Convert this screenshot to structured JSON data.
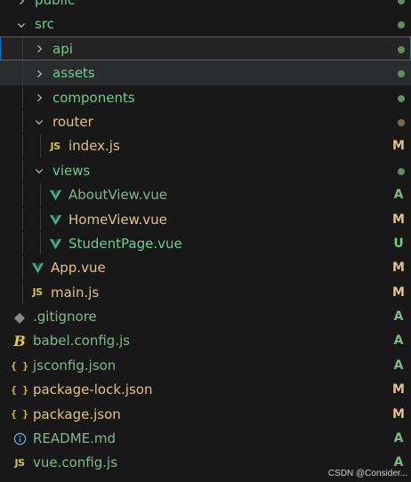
{
  "colors": {
    "untracked": "#73c991",
    "added": "#81b88b",
    "modified": "#e2c08d",
    "dot_green": "#5f8f5f",
    "dot_brown": "#7d6a4d",
    "vue_green": "#41b883",
    "info_blue": "#6ca6d9"
  },
  "tree": [
    {
      "label": "public",
      "type": "folder",
      "depth": 1,
      "expanded": false,
      "status": "dot",
      "dotColor": "#5f8f5f",
      "color": "#73c991"
    },
    {
      "label": "src",
      "type": "folder",
      "depth": 1,
      "expanded": true,
      "status": "dot",
      "dotColor": "#5f8f5f",
      "color": "#73c991"
    },
    {
      "label": "api",
      "type": "folder",
      "depth": 2,
      "expanded": false,
      "status": "dot",
      "dotColor": "#5f8f5f",
      "color": "#73c991",
      "selected": true
    },
    {
      "label": "assets",
      "type": "folder",
      "depth": 2,
      "expanded": false,
      "status": "dot",
      "dotColor": "#5f8f5f",
      "color": "#73c991",
      "hovered": true
    },
    {
      "label": "components",
      "type": "folder",
      "depth": 2,
      "expanded": false,
      "status": "dot",
      "dotColor": "#5f8f5f",
      "color": "#73c991"
    },
    {
      "label": "router",
      "type": "folder",
      "depth": 2,
      "expanded": true,
      "status": "dot",
      "dotColor": "#7d6a4d",
      "color": "#e2c08d"
    },
    {
      "label": "index.js",
      "type": "js",
      "depth": 3,
      "status": "M",
      "color": "#e2c08d"
    },
    {
      "label": "views",
      "type": "folder",
      "depth": 2,
      "expanded": true,
      "status": "dot",
      "dotColor": "#5f8f5f",
      "color": "#73c991"
    },
    {
      "label": "AboutView.vue",
      "type": "vue",
      "depth": 3,
      "status": "A",
      "color": "#81b88b"
    },
    {
      "label": "HomeView.vue",
      "type": "vue",
      "depth": 3,
      "status": "M",
      "color": "#e2c08d"
    },
    {
      "label": "StudentPage.vue",
      "type": "vue",
      "depth": 3,
      "status": "U",
      "color": "#73c991"
    },
    {
      "label": "App.vue",
      "type": "vue",
      "depth": 2,
      "status": "M",
      "color": "#e2c08d"
    },
    {
      "label": "main.js",
      "type": "js",
      "depth": 2,
      "status": "M",
      "color": "#e2c08d"
    },
    {
      "label": ".gitignore",
      "type": "git",
      "depth": 1,
      "status": "A",
      "color": "#81b88b"
    },
    {
      "label": "babel.config.js",
      "type": "babel",
      "depth": 1,
      "status": "A",
      "color": "#81b88b"
    },
    {
      "label": "jsconfig.json",
      "type": "json",
      "depth": 1,
      "status": "A",
      "color": "#81b88b"
    },
    {
      "label": "package-lock.json",
      "type": "json",
      "depth": 1,
      "status": "M",
      "color": "#e2c08d"
    },
    {
      "label": "package.json",
      "type": "json",
      "depth": 1,
      "status": "M",
      "color": "#e2c08d"
    },
    {
      "label": "README.md",
      "type": "info",
      "depth": 1,
      "status": "A",
      "color": "#81b88b"
    },
    {
      "label": "vue.config.js",
      "type": "js",
      "depth": 1,
      "status": "A",
      "color": "#81b88b"
    }
  ],
  "icon_text": {
    "js": "JS",
    "json": "{ }",
    "babel": "B",
    "git": "◆"
  },
  "watermark": "CSDN @Consider..."
}
